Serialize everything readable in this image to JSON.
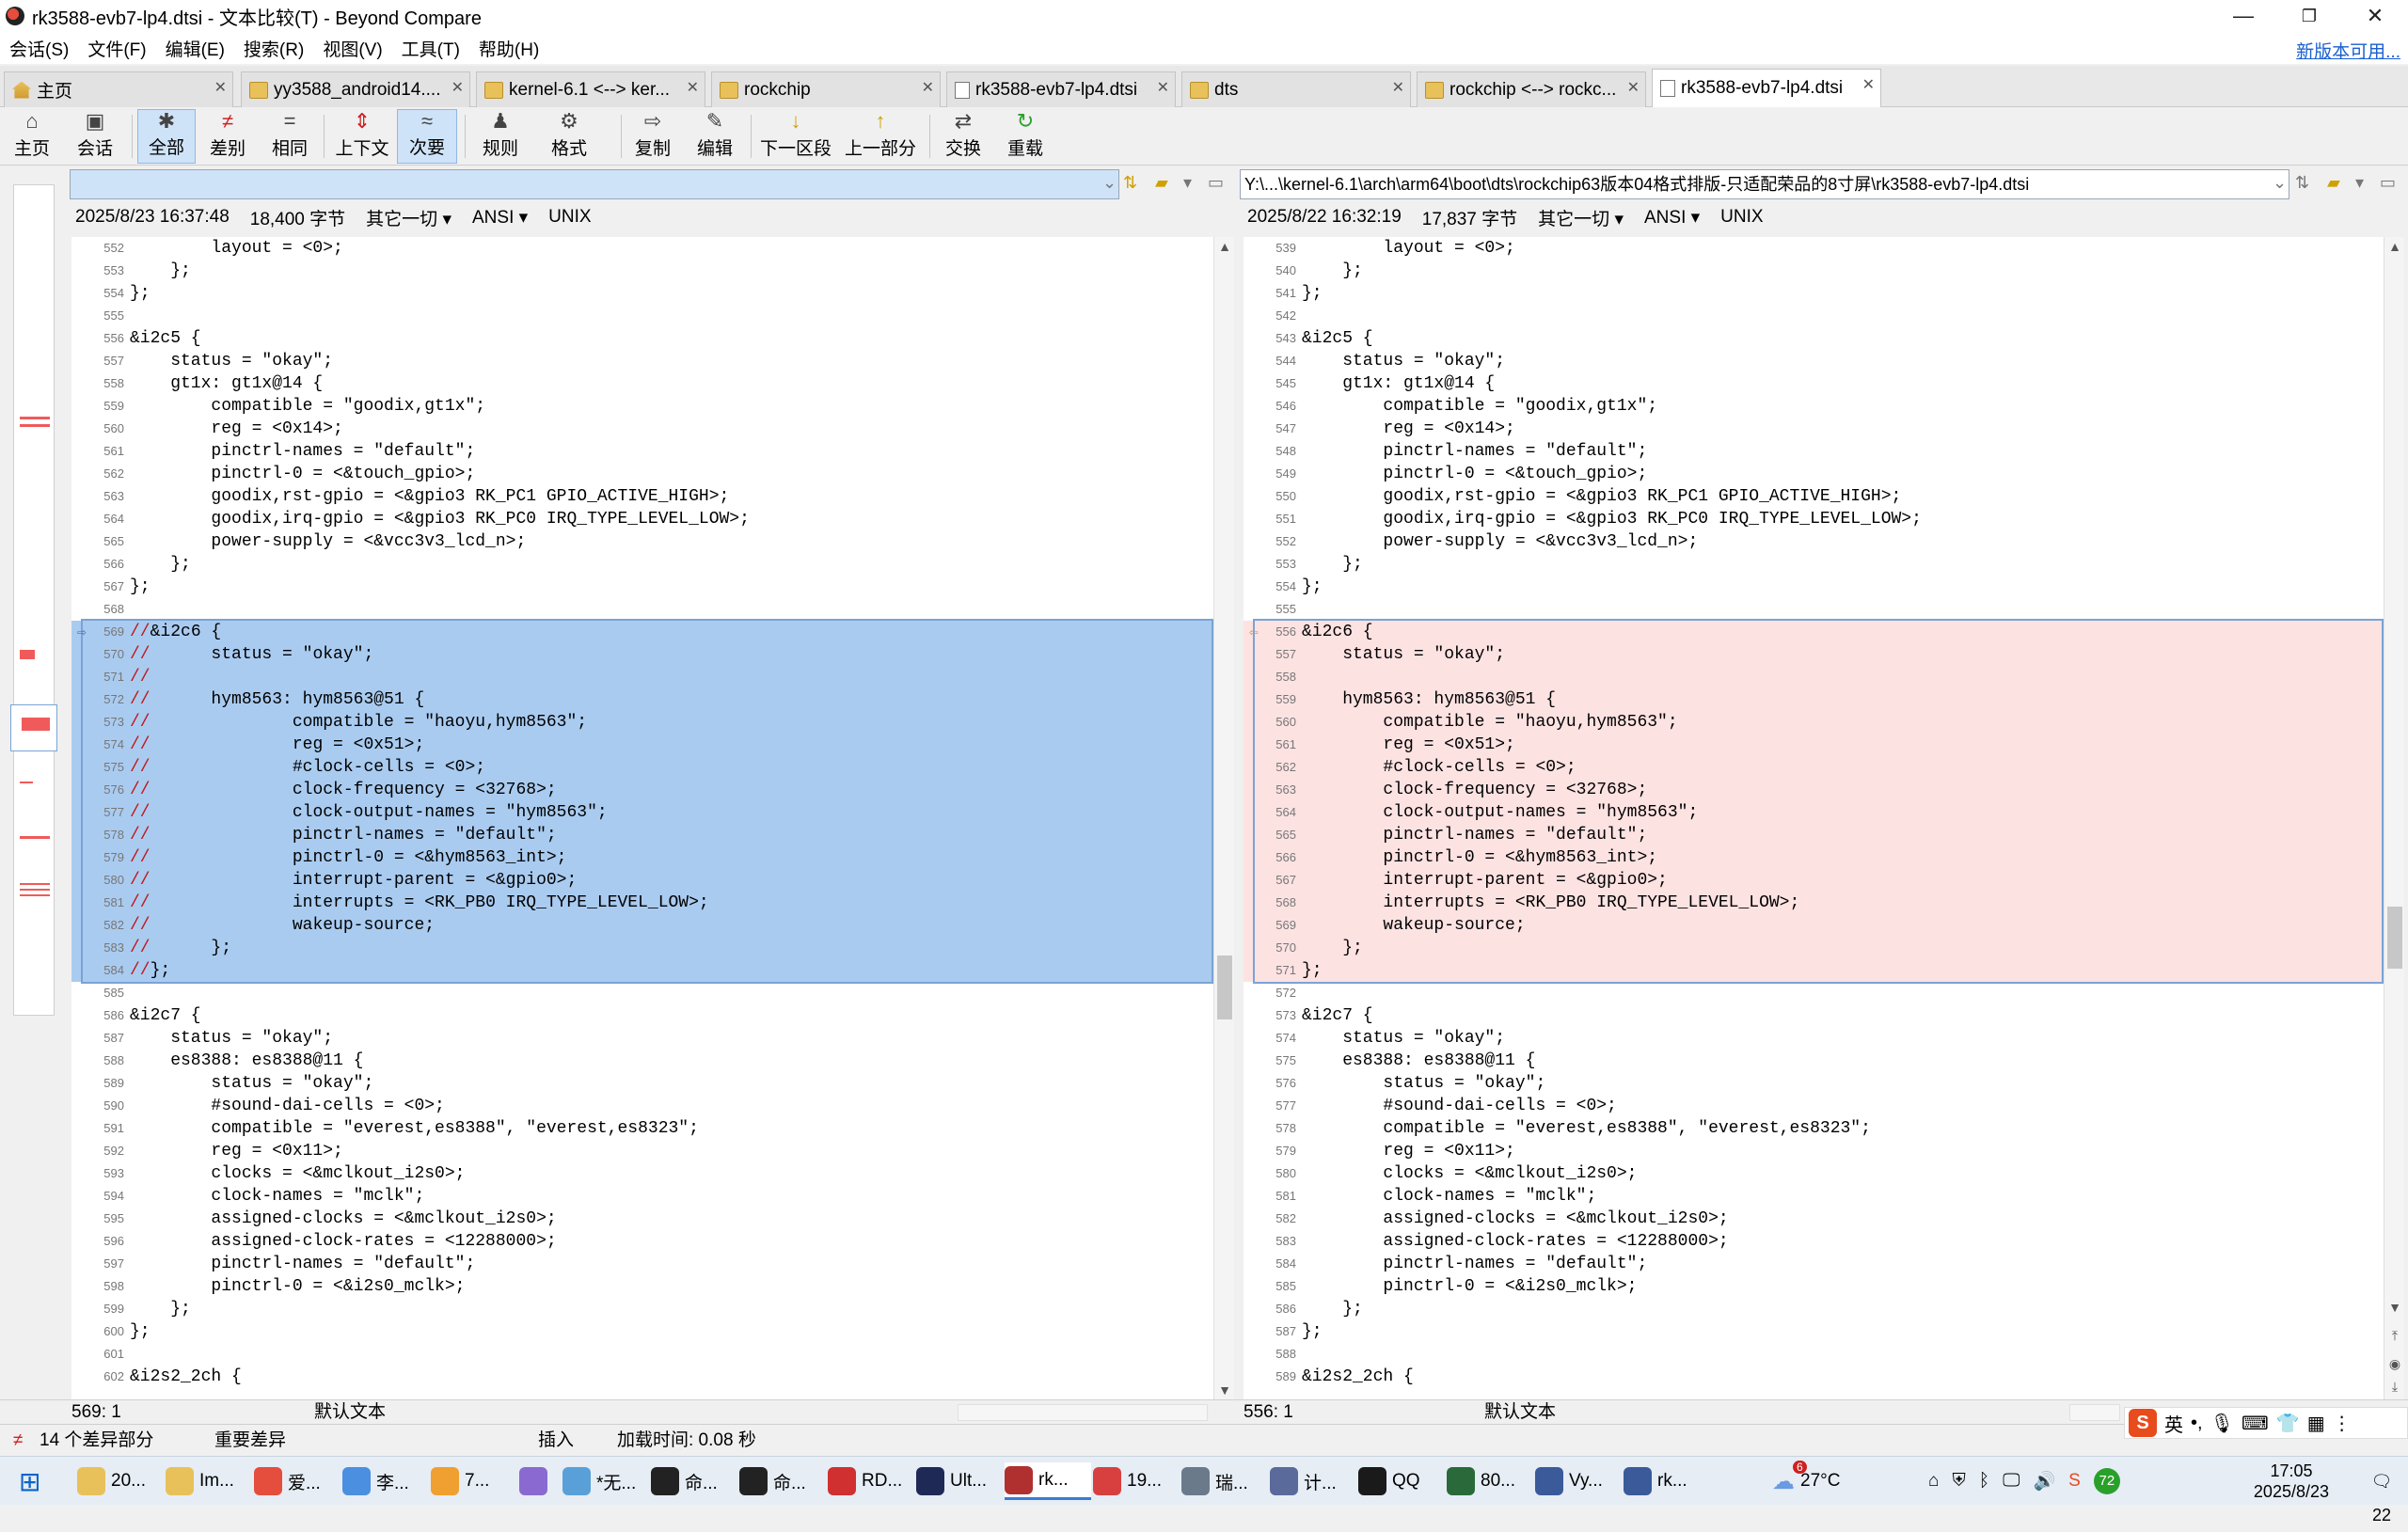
{
  "window": {
    "title": "rk3588-evb7-lp4.dtsi - 文本比较(T) - Beyond Compare",
    "minimize": "—",
    "restore": "❐",
    "close": "✕"
  },
  "menu": {
    "items": [
      "会话(S)",
      "文件(F)",
      "编辑(E)",
      "搜索(R)",
      "视图(V)",
      "工具(T)",
      "帮助(H)"
    ],
    "update_link": "新版本可用..."
  },
  "tabs": [
    {
      "label": "主页",
      "icon": "home-icon"
    },
    {
      "label": "yy3588_android14....",
      "icon": "folder-icon"
    },
    {
      "label": "kernel-6.1 <--> ker...",
      "icon": "folder-icon"
    },
    {
      "label": "rockchip",
      "icon": "folder-icon"
    },
    {
      "label": "rk3588-evb7-lp4.dtsi",
      "icon": "file-icon"
    },
    {
      "label": "dts",
      "icon": "folder-icon"
    },
    {
      "label": "rockchip <--> rockc...",
      "icon": "folder-icon"
    },
    {
      "label": "rk3588-evb7-lp4.dtsi",
      "icon": "file-icon"
    }
  ],
  "toolbar": {
    "buttons": [
      {
        "label": "主页",
        "glyph": "⌂"
      },
      {
        "label": "会话",
        "glyph": "▣"
      },
      {
        "label": "全部",
        "glyph": "✱"
      },
      {
        "label": "差别",
        "glyph": "≠"
      },
      {
        "label": "相同",
        "glyph": "="
      },
      {
        "label": "上下文",
        "glyph": "⇕"
      },
      {
        "label": "次要",
        "glyph": "≈"
      },
      {
        "label": "规则",
        "glyph": "♟"
      },
      {
        "label": "格式",
        "glyph": "⚙"
      },
      {
        "label": "复制",
        "glyph": "⇨"
      },
      {
        "label": "编辑",
        "glyph": "✎"
      },
      {
        "label": "下一区段",
        "glyph": "↓"
      },
      {
        "label": "上一部分",
        "glyph": "↑"
      },
      {
        "label": "交换",
        "glyph": "⇄"
      },
      {
        "label": "重载",
        "glyph": "↻"
      }
    ]
  },
  "paths": {
    "left": "",
    "right": "Y:\\...\\kernel-6.1\\arch\\arm64\\boot\\dts\\rockchip63版本04格式排版-只适配荣品的8寸屏\\rk3588-evb7-lp4.dtsi"
  },
  "info": {
    "left": {
      "date": "2025/8/23 16:37:48",
      "size": "18,400 字节",
      "other": "其它一切 ▾",
      "encoding": "ANSI ▾",
      "eol": "UNIX"
    },
    "right": {
      "date": "2025/8/22 16:32:19",
      "size": "17,837 字节",
      "other": "其它一切 ▾",
      "encoding": "ANSI ▾",
      "eol": "UNIX"
    }
  },
  "left_lines": [
    {
      "n": "552",
      "t": "        layout = <0>;",
      "d": 0
    },
    {
      "n": "553",
      "t": "    };",
      "d": 0
    },
    {
      "n": "554",
      "t": "};",
      "d": 0
    },
    {
      "n": "555",
      "t": "",
      "d": 0
    },
    {
      "n": "556",
      "t": "&i2c5 {",
      "d": 0
    },
    {
      "n": "557",
      "t": "    status = \"okay\";",
      "d": 0
    },
    {
      "n": "558",
      "t": "    gt1x: gt1x@14 {",
      "d": 0
    },
    {
      "n": "559",
      "t": "        compatible = \"goodix,gt1x\";",
      "d": 0
    },
    {
      "n": "560",
      "t": "        reg = <0x14>;",
      "d": 0
    },
    {
      "n": "561",
      "t": "        pinctrl-names = \"default\";",
      "d": 0
    },
    {
      "n": "562",
      "t": "        pinctrl-0 = <&touch_gpio>;",
      "d": 0
    },
    {
      "n": "563",
      "t": "        goodix,rst-gpio = <&gpio3 RK_PC1 GPIO_ACTIVE_HIGH>;",
      "d": 0
    },
    {
      "n": "564",
      "t": "        goodix,irq-gpio = <&gpio3 RK_PC0 IRQ_TYPE_LEVEL_LOW>;",
      "d": 0
    },
    {
      "n": "565",
      "t": "        power-supply = <&vcc3v3_lcd_n>;",
      "d": 0
    },
    {
      "n": "566",
      "t": "    };",
      "d": 0
    },
    {
      "n": "567",
      "t": "};",
      "d": 0
    },
    {
      "n": "568",
      "t": "",
      "d": 0
    },
    {
      "n": "569",
      "t": "//&i2c6 {",
      "d": 1
    },
    {
      "n": "570",
      "t": "//      status = \"okay\";",
      "d": 1
    },
    {
      "n": "571",
      "t": "//",
      "d": 1
    },
    {
      "n": "572",
      "t": "//      hym8563: hym8563@51 {",
      "d": 1
    },
    {
      "n": "573",
      "t": "//              compatible = \"haoyu,hym8563\";",
      "d": 1
    },
    {
      "n": "574",
      "t": "//              reg = <0x51>;",
      "d": 1
    },
    {
      "n": "575",
      "t": "//              #clock-cells = <0>;",
      "d": 1
    },
    {
      "n": "576",
      "t": "//              clock-frequency = <32768>;",
      "d": 1
    },
    {
      "n": "577",
      "t": "//              clock-output-names = \"hym8563\";",
      "d": 1
    },
    {
      "n": "578",
      "t": "//              pinctrl-names = \"default\";",
      "d": 1
    },
    {
      "n": "579",
      "t": "//              pinctrl-0 = <&hym8563_int>;",
      "d": 1
    },
    {
      "n": "580",
      "t": "//              interrupt-parent = <&gpio0>;",
      "d": 1
    },
    {
      "n": "581",
      "t": "//              interrupts = <RK_PB0 IRQ_TYPE_LEVEL_LOW>;",
      "d": 1
    },
    {
      "n": "582",
      "t": "//              wakeup-source;",
      "d": 1
    },
    {
      "n": "583",
      "t": "//      };",
      "d": 1
    },
    {
      "n": "584",
      "t": "//};",
      "d": 1
    },
    {
      "n": "585",
      "t": "",
      "d": 0
    },
    {
      "n": "586",
      "t": "&i2c7 {",
      "d": 0
    },
    {
      "n": "587",
      "t": "    status = \"okay\";",
      "d": 0
    },
    {
      "n": "588",
      "t": "    es8388: es8388@11 {",
      "d": 0
    },
    {
      "n": "589",
      "t": "        status = \"okay\";",
      "d": 0
    },
    {
      "n": "590",
      "t": "        #sound-dai-cells = <0>;",
      "d": 0
    },
    {
      "n": "591",
      "t": "        compatible = \"everest,es8388\", \"everest,es8323\";",
      "d": 0
    },
    {
      "n": "592",
      "t": "        reg = <0x11>;",
      "d": 0
    },
    {
      "n": "593",
      "t": "        clocks = <&mclkout_i2s0>;",
      "d": 0
    },
    {
      "n": "594",
      "t": "        clock-names = \"mclk\";",
      "d": 0
    },
    {
      "n": "595",
      "t": "        assigned-clocks = <&mclkout_i2s0>;",
      "d": 0
    },
    {
      "n": "596",
      "t": "        assigned-clock-rates = <12288000>;",
      "d": 0
    },
    {
      "n": "597",
      "t": "        pinctrl-names = \"default\";",
      "d": 0
    },
    {
      "n": "598",
      "t": "        pinctrl-0 = <&i2s0_mclk>;",
      "d": 0
    },
    {
      "n": "599",
      "t": "    };",
      "d": 0
    },
    {
      "n": "600",
      "t": "};",
      "d": 0
    },
    {
      "n": "601",
      "t": "",
      "d": 0
    },
    {
      "n": "602",
      "t": "&i2s2_2ch {",
      "d": 0
    }
  ],
  "right_lines": [
    {
      "n": "539",
      "t": "        layout = <0>;",
      "d": 0
    },
    {
      "n": "540",
      "t": "    };",
      "d": 0
    },
    {
      "n": "541",
      "t": "};",
      "d": 0
    },
    {
      "n": "542",
      "t": "",
      "d": 0
    },
    {
      "n": "543",
      "t": "&i2c5 {",
      "d": 0
    },
    {
      "n": "544",
      "t": "    status = \"okay\";",
      "d": 0
    },
    {
      "n": "545",
      "t": "    gt1x: gt1x@14 {",
      "d": 0
    },
    {
      "n": "546",
      "t": "        compatible = \"goodix,gt1x\";",
      "d": 0
    },
    {
      "n": "547",
      "t": "        reg = <0x14>;",
      "d": 0
    },
    {
      "n": "548",
      "t": "        pinctrl-names = \"default\";",
      "d": 0
    },
    {
      "n": "549",
      "t": "        pinctrl-0 = <&touch_gpio>;",
      "d": 0
    },
    {
      "n": "550",
      "t": "        goodix,rst-gpio = <&gpio3 RK_PC1 GPIO_ACTIVE_HIGH>;",
      "d": 0
    },
    {
      "n": "551",
      "t": "        goodix,irq-gpio = <&gpio3 RK_PC0 IRQ_TYPE_LEVEL_LOW>;",
      "d": 0
    },
    {
      "n": "552",
      "t": "        power-supply = <&vcc3v3_lcd_n>;",
      "d": 0
    },
    {
      "n": "553",
      "t": "    };",
      "d": 0
    },
    {
      "n": "554",
      "t": "};",
      "d": 0
    },
    {
      "n": "555",
      "t": "",
      "d": 0
    },
    {
      "n": "556",
      "t": "&i2c6 {",
      "d": 1
    },
    {
      "n": "557",
      "t": "    status = \"okay\";",
      "d": 1
    },
    {
      "n": "558",
      "t": "",
      "d": 1
    },
    {
      "n": "559",
      "t": "    hym8563: hym8563@51 {",
      "d": 1
    },
    {
      "n": "560",
      "t": "        compatible = \"haoyu,hym8563\";",
      "d": 1
    },
    {
      "n": "561",
      "t": "        reg = <0x51>;",
      "d": 1
    },
    {
      "n": "562",
      "t": "        #clock-cells = <0>;",
      "d": 1
    },
    {
      "n": "563",
      "t": "        clock-frequency = <32768>;",
      "d": 1
    },
    {
      "n": "564",
      "t": "        clock-output-names = \"hym8563\";",
      "d": 1
    },
    {
      "n": "565",
      "t": "        pinctrl-names = \"default\";",
      "d": 1
    },
    {
      "n": "566",
      "t": "        pinctrl-0 = <&hym8563_int>;",
      "d": 1
    },
    {
      "n": "567",
      "t": "        interrupt-parent = <&gpio0>;",
      "d": 1
    },
    {
      "n": "568",
      "t": "        interrupts = <RK_PB0 IRQ_TYPE_LEVEL_LOW>;",
      "d": 1
    },
    {
      "n": "569",
      "t": "        wakeup-source;",
      "d": 1
    },
    {
      "n": "570",
      "t": "    };",
      "d": 1
    },
    {
      "n": "571",
      "t": "};",
      "d": 1
    },
    {
      "n": "572",
      "t": "",
      "d": 0
    },
    {
      "n": "573",
      "t": "&i2c7 {",
      "d": 0
    },
    {
      "n": "574",
      "t": "    status = \"okay\";",
      "d": 0
    },
    {
      "n": "575",
      "t": "    es8388: es8388@11 {",
      "d": 0
    },
    {
      "n": "576",
      "t": "        status = \"okay\";",
      "d": 0
    },
    {
      "n": "577",
      "t": "        #sound-dai-cells = <0>;",
      "d": 0
    },
    {
      "n": "578",
      "t": "        compatible = \"everest,es8388\", \"everest,es8323\";",
      "d": 0
    },
    {
      "n": "579",
      "t": "        reg = <0x11>;",
      "d": 0
    },
    {
      "n": "580",
      "t": "        clocks = <&mclkout_i2s0>;",
      "d": 0
    },
    {
      "n": "581",
      "t": "        clock-names = \"mclk\";",
      "d": 0
    },
    {
      "n": "582",
      "t": "        assigned-clocks = <&mclkout_i2s0>;",
      "d": 0
    },
    {
      "n": "583",
      "t": "        assigned-clock-rates = <12288000>;",
      "d": 0
    },
    {
      "n": "584",
      "t": "        pinctrl-names = \"default\";",
      "d": 0
    },
    {
      "n": "585",
      "t": "        pinctrl-0 = <&i2s0_mclk>;",
      "d": 0
    },
    {
      "n": "586",
      "t": "    };",
      "d": 0
    },
    {
      "n": "587",
      "t": "};",
      "d": 0
    },
    {
      "n": "588",
      "t": "",
      "d": 0
    },
    {
      "n": "589",
      "t": "&i2s2_2ch {",
      "d": 0
    }
  ],
  "pane_status": {
    "left_pos": "569: 1",
    "left_style": "默认文本",
    "right_pos": "556: 1",
    "right_style": "默认文本"
  },
  "status": {
    "diff_count": "14 个差异部分",
    "importance": "重要差异",
    "mode": "插入",
    "load_time": "加载时间: 0.08 秒"
  },
  "ime": {
    "logo": "S",
    "lang": "英"
  },
  "taskbar": {
    "apps": [
      {
        "label": "20...",
        "color": "#e8c15a"
      },
      {
        "label": "Im...",
        "color": "#e8c15a"
      },
      {
        "label": "爱...",
        "color": "#e54d3c"
      },
      {
        "label": "李...",
        "color": "#4a8fe0"
      },
      {
        "label": "7...",
        "color": "#f0a030"
      },
      {
        "label": "",
        "color": "#8a6ad0"
      },
      {
        "label": "*无...",
        "color": "#5aa0d8"
      },
      {
        "label": "命...",
        "color": "#222222"
      },
      {
        "label": "命...",
        "color": "#222222"
      },
      {
        "label": "RD...",
        "color": "#d03030"
      },
      {
        "label": "Ult...",
        "color": "#1e2a55"
      },
      {
        "label": "rk...",
        "color": "#b03030"
      },
      {
        "label": "19...",
        "color": "#d84040"
      },
      {
        "label": "瑞...",
        "color": "#6a7a8a"
      },
      {
        "label": "计...",
        "color": "#5a6a9a"
      },
      {
        "label": "QQ",
        "color": "#1a1a1a"
      },
      {
        "label": "80...",
        "color": "#2a6a3a"
      },
      {
        "label": "Vy...",
        "color": "#3a5a9a"
      },
      {
        "label": "rk...",
        "color": "#3a5a9a"
      }
    ],
    "weather": "27°C",
    "weather_badge": "6",
    "badge_72": "72",
    "time": "17:05",
    "date": "2025/8/23",
    "notifications": "22"
  }
}
